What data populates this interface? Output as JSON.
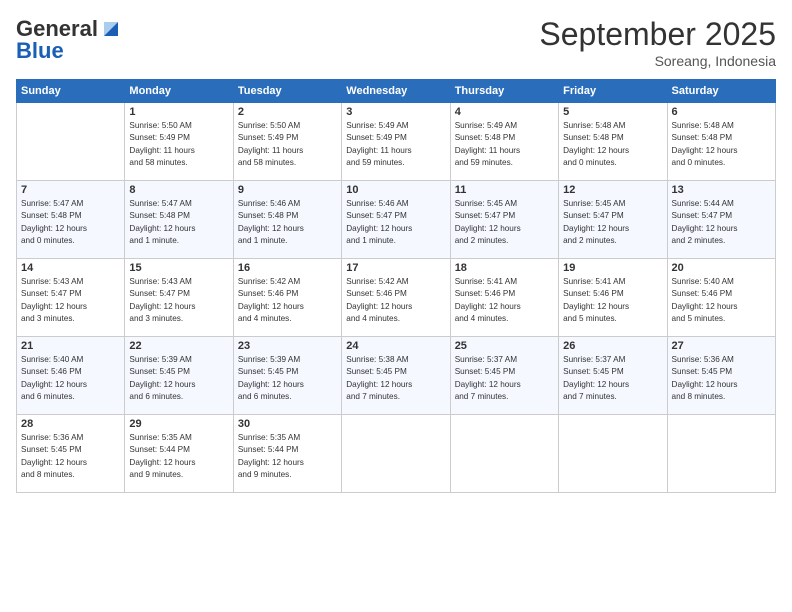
{
  "header": {
    "logo_general": "General",
    "logo_blue": "Blue",
    "month": "September 2025",
    "location": "Soreang, Indonesia"
  },
  "days_of_week": [
    "Sunday",
    "Monday",
    "Tuesday",
    "Wednesday",
    "Thursday",
    "Friday",
    "Saturday"
  ],
  "weeks": [
    [
      {
        "day": "",
        "info": ""
      },
      {
        "day": "1",
        "info": "Sunrise: 5:50 AM\nSunset: 5:49 PM\nDaylight: 11 hours\nand 58 minutes."
      },
      {
        "day": "2",
        "info": "Sunrise: 5:50 AM\nSunset: 5:49 PM\nDaylight: 11 hours\nand 58 minutes."
      },
      {
        "day": "3",
        "info": "Sunrise: 5:49 AM\nSunset: 5:49 PM\nDaylight: 11 hours\nand 59 minutes."
      },
      {
        "day": "4",
        "info": "Sunrise: 5:49 AM\nSunset: 5:48 PM\nDaylight: 11 hours\nand 59 minutes."
      },
      {
        "day": "5",
        "info": "Sunrise: 5:48 AM\nSunset: 5:48 PM\nDaylight: 12 hours\nand 0 minutes."
      },
      {
        "day": "6",
        "info": "Sunrise: 5:48 AM\nSunset: 5:48 PM\nDaylight: 12 hours\nand 0 minutes."
      }
    ],
    [
      {
        "day": "7",
        "info": "Sunrise: 5:47 AM\nSunset: 5:48 PM\nDaylight: 12 hours\nand 0 minutes."
      },
      {
        "day": "8",
        "info": "Sunrise: 5:47 AM\nSunset: 5:48 PM\nDaylight: 12 hours\nand 1 minute."
      },
      {
        "day": "9",
        "info": "Sunrise: 5:46 AM\nSunset: 5:48 PM\nDaylight: 12 hours\nand 1 minute."
      },
      {
        "day": "10",
        "info": "Sunrise: 5:46 AM\nSunset: 5:47 PM\nDaylight: 12 hours\nand 1 minute."
      },
      {
        "day": "11",
        "info": "Sunrise: 5:45 AM\nSunset: 5:47 PM\nDaylight: 12 hours\nand 2 minutes."
      },
      {
        "day": "12",
        "info": "Sunrise: 5:45 AM\nSunset: 5:47 PM\nDaylight: 12 hours\nand 2 minutes."
      },
      {
        "day": "13",
        "info": "Sunrise: 5:44 AM\nSunset: 5:47 PM\nDaylight: 12 hours\nand 2 minutes."
      }
    ],
    [
      {
        "day": "14",
        "info": "Sunrise: 5:43 AM\nSunset: 5:47 PM\nDaylight: 12 hours\nand 3 minutes."
      },
      {
        "day": "15",
        "info": "Sunrise: 5:43 AM\nSunset: 5:47 PM\nDaylight: 12 hours\nand 3 minutes."
      },
      {
        "day": "16",
        "info": "Sunrise: 5:42 AM\nSunset: 5:46 PM\nDaylight: 12 hours\nand 4 minutes."
      },
      {
        "day": "17",
        "info": "Sunrise: 5:42 AM\nSunset: 5:46 PM\nDaylight: 12 hours\nand 4 minutes."
      },
      {
        "day": "18",
        "info": "Sunrise: 5:41 AM\nSunset: 5:46 PM\nDaylight: 12 hours\nand 4 minutes."
      },
      {
        "day": "19",
        "info": "Sunrise: 5:41 AM\nSunset: 5:46 PM\nDaylight: 12 hours\nand 5 minutes."
      },
      {
        "day": "20",
        "info": "Sunrise: 5:40 AM\nSunset: 5:46 PM\nDaylight: 12 hours\nand 5 minutes."
      }
    ],
    [
      {
        "day": "21",
        "info": "Sunrise: 5:40 AM\nSunset: 5:46 PM\nDaylight: 12 hours\nand 6 minutes."
      },
      {
        "day": "22",
        "info": "Sunrise: 5:39 AM\nSunset: 5:45 PM\nDaylight: 12 hours\nand 6 minutes."
      },
      {
        "day": "23",
        "info": "Sunrise: 5:39 AM\nSunset: 5:45 PM\nDaylight: 12 hours\nand 6 minutes."
      },
      {
        "day": "24",
        "info": "Sunrise: 5:38 AM\nSunset: 5:45 PM\nDaylight: 12 hours\nand 7 minutes."
      },
      {
        "day": "25",
        "info": "Sunrise: 5:37 AM\nSunset: 5:45 PM\nDaylight: 12 hours\nand 7 minutes."
      },
      {
        "day": "26",
        "info": "Sunrise: 5:37 AM\nSunset: 5:45 PM\nDaylight: 12 hours\nand 7 minutes."
      },
      {
        "day": "27",
        "info": "Sunrise: 5:36 AM\nSunset: 5:45 PM\nDaylight: 12 hours\nand 8 minutes."
      }
    ],
    [
      {
        "day": "28",
        "info": "Sunrise: 5:36 AM\nSunset: 5:45 PM\nDaylight: 12 hours\nand 8 minutes."
      },
      {
        "day": "29",
        "info": "Sunrise: 5:35 AM\nSunset: 5:44 PM\nDaylight: 12 hours\nand 9 minutes."
      },
      {
        "day": "30",
        "info": "Sunrise: 5:35 AM\nSunset: 5:44 PM\nDaylight: 12 hours\nand 9 minutes."
      },
      {
        "day": "",
        "info": ""
      },
      {
        "day": "",
        "info": ""
      },
      {
        "day": "",
        "info": ""
      },
      {
        "day": "",
        "info": ""
      }
    ]
  ]
}
